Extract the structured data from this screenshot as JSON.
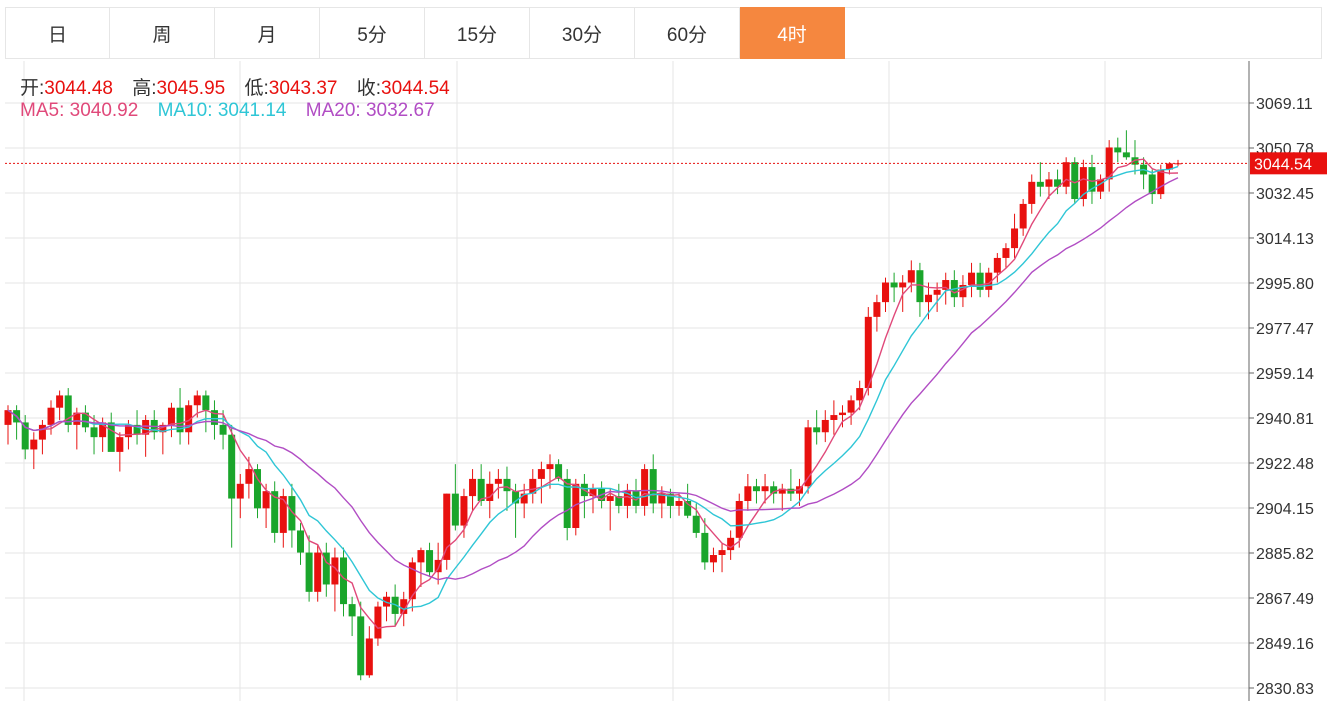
{
  "tabs": [
    "日",
    "周",
    "月",
    "5分",
    "15分",
    "30分",
    "60分",
    "4时"
  ],
  "active_tab": "4时",
  "ohlc_panel": {
    "open_label": "开:",
    "open_value": "3044.48",
    "high_label": "高:",
    "high_value": "3045.95",
    "low_label": "低:",
    "low_value": "3043.37",
    "close_label": "收:",
    "close_value": "3044.54"
  },
  "ma_panel": {
    "ma5_label": "MA5:",
    "ma5_value": "3040.92",
    "ma10_label": "MA10:",
    "ma10_value": "3041.14",
    "ma20_label": "MA20:",
    "ma20_value": "3032.67"
  },
  "colors": {
    "up": "#e8110f",
    "down": "#1aa52b",
    "ma5": "#e0497a",
    "ma10": "#2fc6d6",
    "ma20": "#b14dc4",
    "grid": "#e6e6e6",
    "active_tab": "#f5873f",
    "price_line": "#e8110f"
  },
  "chart_data": {
    "type": "candlestick",
    "current_price": "3044.54",
    "y_ticks": [
      "3069.11",
      "3050.78",
      "3032.45",
      "3014.13",
      "2995.80",
      "2977.47",
      "2959.14",
      "2940.81",
      "2922.48",
      "2904.15",
      "2885.82",
      "2867.49",
      "2849.16",
      "2830.83"
    ],
    "ylim": [
      2830.83,
      3069.11
    ],
    "grid": true,
    "candles": [
      [
        2938,
        2946,
        2930,
        2944
      ],
      [
        2944,
        2946,
        2932,
        2939
      ],
      [
        2939,
        2942,
        2924,
        2928
      ],
      [
        2928,
        2935,
        2920,
        2932
      ],
      [
        2932,
        2940,
        2926,
        2938
      ],
      [
        2938,
        2948,
        2934,
        2945
      ],
      [
        2945,
        2952,
        2940,
        2950
      ],
      [
        2950,
        2953,
        2935,
        2938
      ],
      [
        2938,
        2945,
        2928,
        2943
      ],
      [
        2943,
        2946,
        2935,
        2937
      ],
      [
        2937,
        2942,
        2926,
        2933
      ],
      [
        2933,
        2941,
        2927,
        2939
      ],
      [
        2939,
        2943,
        2930,
        2927
      ],
      [
        2927,
        2935,
        2919,
        2933
      ],
      [
        2933,
        2940,
        2928,
        2938
      ],
      [
        2938,
        2944,
        2930,
        2934
      ],
      [
        2934,
        2942,
        2925,
        2940
      ],
      [
        2940,
        2944,
        2932,
        2935
      ],
      [
        2935,
        2939,
        2926,
        2938
      ],
      [
        2938,
        2947,
        2933,
        2945
      ],
      [
        2945,
        2953,
        2930,
        2935
      ],
      [
        2935,
        2948,
        2930,
        2946
      ],
      [
        2946,
        2952,
        2941,
        2950
      ],
      [
        2950,
        2952,
        2935,
        2944
      ],
      [
        2944,
        2948,
        2932,
        2938
      ],
      [
        2938,
        2944,
        2928,
        2934
      ],
      [
        2934,
        2938,
        2888,
        2908
      ],
      [
        2908,
        2918,
        2900,
        2914
      ],
      [
        2914,
        2925,
        2908,
        2920
      ],
      [
        2920,
        2922,
        2900,
        2904
      ],
      [
        2904,
        2914,
        2896,
        2911
      ],
      [
        2911,
        2915,
        2890,
        2894
      ],
      [
        2894,
        2912,
        2888,
        2909
      ],
      [
        2909,
        2914,
        2888,
        2895
      ],
      [
        2895,
        2898,
        2881,
        2886
      ],
      [
        2886,
        2893,
        2866,
        2870
      ],
      [
        2870,
        2889,
        2866,
        2886
      ],
      [
        2886,
        2890,
        2868,
        2873
      ],
      [
        2873,
        2888,
        2862,
        2884
      ],
      [
        2884,
        2888,
        2860,
        2865
      ],
      [
        2865,
        2868,
        2852,
        2860
      ],
      [
        2860,
        2866,
        2834,
        2836
      ],
      [
        2836,
        2856,
        2835,
        2851
      ],
      [
        2851,
        2866,
        2848,
        2864
      ],
      [
        2864,
        2870,
        2858,
        2868
      ],
      [
        2868,
        2873,
        2856,
        2861
      ],
      [
        2861,
        2870,
        2856,
        2867
      ],
      [
        2867,
        2884,
        2862,
        2882
      ],
      [
        2882,
        2888,
        2872,
        2887
      ],
      [
        2887,
        2890,
        2876,
        2878
      ],
      [
        2878,
        2890,
        2873,
        2883
      ],
      [
        2883,
        2910,
        2879,
        2910
      ],
      [
        2910,
        2922,
        2895,
        2897
      ],
      [
        2897,
        2912,
        2892,
        2909
      ],
      [
        2909,
        2920,
        2903,
        2916
      ],
      [
        2916,
        2922,
        2905,
        2907
      ],
      [
        2907,
        2919,
        2900,
        2914
      ],
      [
        2914,
        2920,
        2908,
        2916
      ],
      [
        2916,
        2921,
        2903,
        2911
      ],
      [
        2911,
        2914,
        2892,
        2906
      ],
      [
        2906,
        2914,
        2900,
        2910
      ],
      [
        2910,
        2920,
        2906,
        2916
      ],
      [
        2916,
        2923,
        2906,
        2920
      ],
      [
        2920,
        2926,
        2912,
        2922
      ],
      [
        2922,
        2924,
        2915,
        2916
      ],
      [
        2916,
        2920,
        2891,
        2896
      ],
      [
        2896,
        2916,
        2893,
        2914
      ],
      [
        2914,
        2918,
        2900,
        2909
      ],
      [
        2909,
        2914,
        2902,
        2912
      ],
      [
        2912,
        2915,
        2904,
        2907
      ],
      [
        2907,
        2912,
        2895,
        2909
      ],
      [
        2909,
        2914,
        2902,
        2905
      ],
      [
        2905,
        2914,
        2900,
        2911
      ],
      [
        2911,
        2916,
        2902,
        2905
      ],
      [
        2905,
        2922,
        2901,
        2920
      ],
      [
        2920,
        2926,
        2902,
        2906
      ],
      [
        2906,
        2913,
        2900,
        2910
      ],
      [
        2910,
        2912,
        2900,
        2905
      ],
      [
        2905,
        2910,
        2901,
        2907
      ],
      [
        2907,
        2914,
        2900,
        2901
      ],
      [
        2901,
        2906,
        2892,
        2894
      ],
      [
        2894,
        2900,
        2879,
        2882
      ],
      [
        2882,
        2888,
        2878,
        2885
      ],
      [
        2885,
        2890,
        2878,
        2887
      ],
      [
        2887,
        2895,
        2883,
        2892
      ],
      [
        2892,
        2910,
        2888,
        2907
      ],
      [
        2907,
        2918,
        2903,
        2913
      ],
      [
        2913,
        2916,
        2906,
        2911
      ],
      [
        2911,
        2918,
        2906,
        2913
      ],
      [
        2913,
        2915,
        2906,
        2910
      ],
      [
        2910,
        2914,
        2903,
        2912
      ],
      [
        2912,
        2920,
        2907,
        2910
      ],
      [
        2910,
        2916,
        2905,
        2913
      ],
      [
        2913,
        2940,
        2910,
        2937
      ],
      [
        2937,
        2944,
        2930,
        2935
      ],
      [
        2935,
        2944,
        2931,
        2940
      ],
      [
        2940,
        2948,
        2934,
        2942
      ],
      [
        2942,
        2946,
        2937,
        2943
      ],
      [
        2943,
        2950,
        2938,
        2948
      ],
      [
        2948,
        2956,
        2944,
        2953
      ],
      [
        2953,
        2986,
        2950,
        2982
      ],
      [
        2982,
        2991,
        2976,
        2988
      ],
      [
        2988,
        2998,
        2984,
        2996
      ],
      [
        2996,
        3000,
        2988,
        2994
      ],
      [
        2994,
        2999,
        2984,
        2996
      ],
      [
        2996,
        3005,
        2992,
        3001
      ],
      [
        3001,
        3004,
        2982,
        2988
      ],
      [
        2988,
        2996,
        2981,
        2991
      ],
      [
        2991,
        2996,
        2984,
        2993
      ],
      [
        2993,
        3000,
        2987,
        2997
      ],
      [
        2997,
        3001,
        2986,
        2990
      ],
      [
        2990,
        2999,
        2986,
        2995
      ],
      [
        2995,
        3004,
        2990,
        3000
      ],
      [
        3000,
        3004,
        2990,
        2993
      ],
      [
        2993,
        3002,
        2990,
        3000
      ],
      [
        3000,
        3008,
        2996,
        3006
      ],
      [
        3006,
        3012,
        3002,
        3010
      ],
      [
        3010,
        3024,
        3006,
        3018
      ],
      [
        3018,
        3030,
        3015,
        3028
      ],
      [
        3028,
        3040,
        3024,
        3037
      ],
      [
        3037,
        3045,
        3031,
        3035
      ],
      [
        3035,
        3041,
        3030,
        3038
      ],
      [
        3038,
        3042,
        3032,
        3035
      ],
      [
        3035,
        3047,
        3032,
        3045
      ],
      [
        3045,
        3047,
        3028,
        3030
      ],
      [
        3030,
        3046,
        3027,
        3043
      ],
      [
        3043,
        3048,
        3028,
        3033
      ],
      [
        3033,
        3040,
        3030,
        3038
      ],
      [
        3038,
        3054,
        3033,
        3051
      ],
      [
        3051,
        3055,
        3045,
        3049
      ],
      [
        3049,
        3058,
        3046,
        3047
      ],
      [
        3047,
        3054,
        3040,
        3044
      ],
      [
        3044,
        3047,
        3034,
        3040
      ],
      [
        3040,
        3042,
        3028,
        3032
      ],
      [
        3032,
        3044,
        3030,
        3042
      ],
      [
        3042,
        3045,
        3040,
        3044.5
      ],
      [
        3044.48,
        3045.95,
        3043.37,
        3044.54
      ]
    ]
  }
}
